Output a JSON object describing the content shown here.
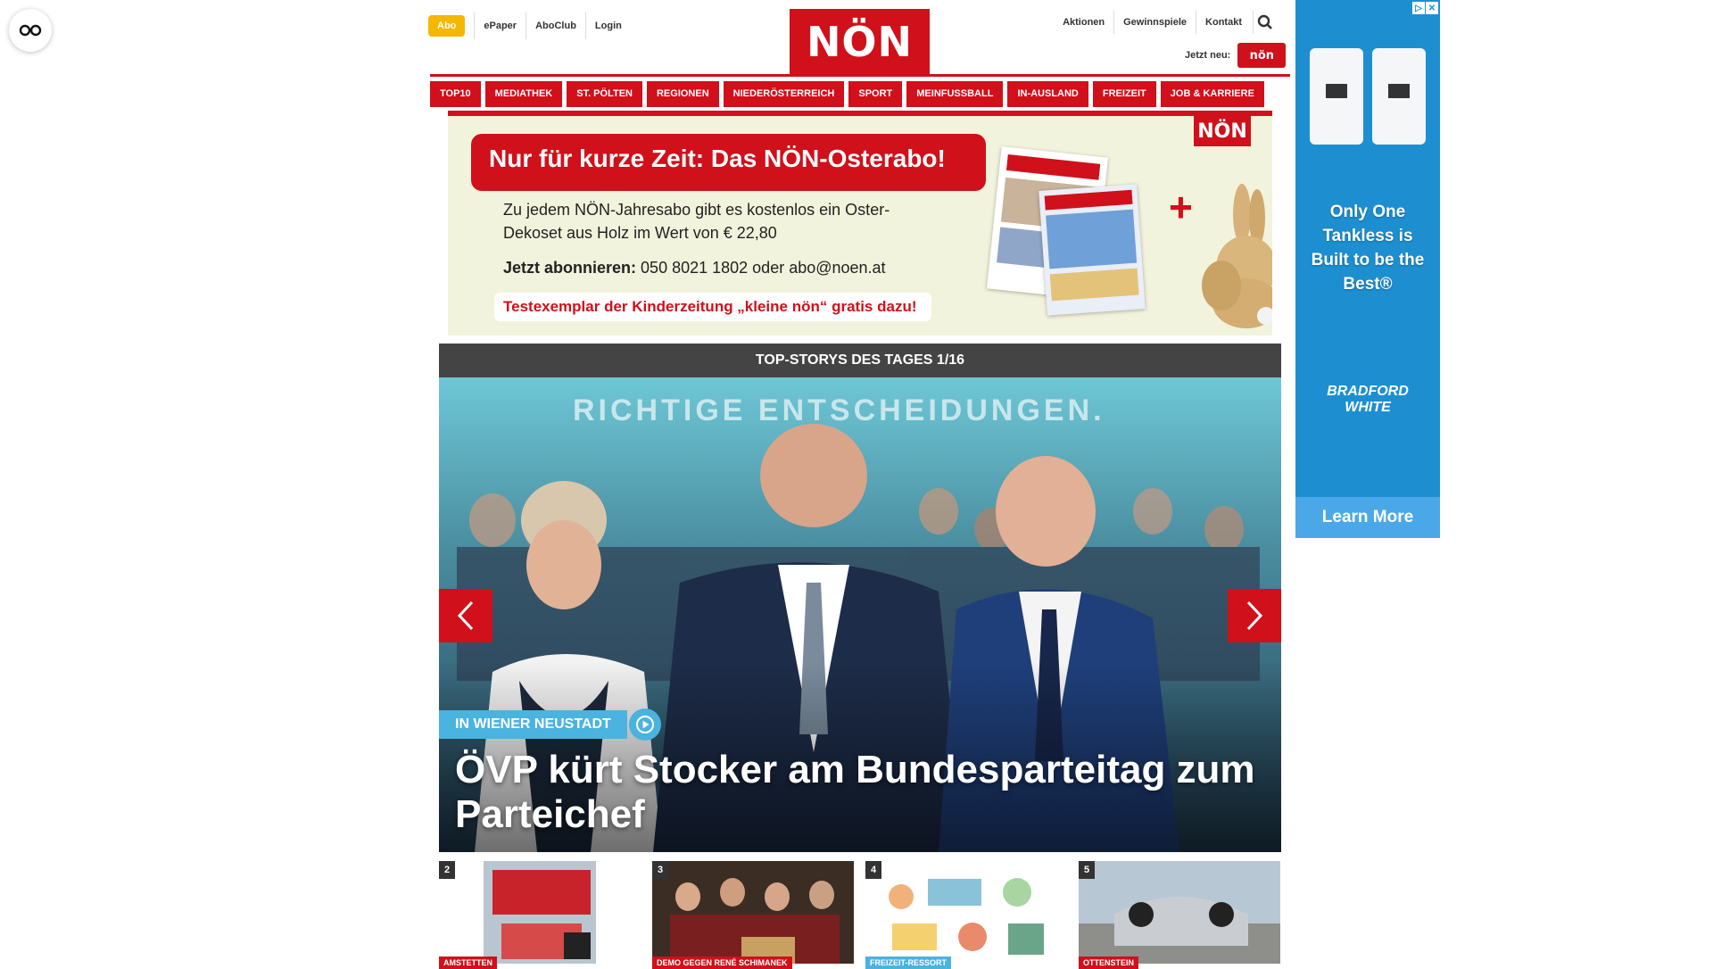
{
  "header": {
    "abo": "Abo",
    "left_links": [
      "ePaper",
      "AboClub",
      "Login"
    ],
    "logo": "NÖN",
    "right_links": [
      "Aktionen",
      "Gewinnspiele",
      "Kontakt"
    ],
    "jetzt_neu": "Jetzt neu:",
    "kleine_logo": "nön"
  },
  "nav": [
    "TOP10",
    "MEDIATHEK",
    "ST. PÖLTEN",
    "REGIONEN",
    "NIEDERÖSTERREICH",
    "SPORT",
    "MEINFUSSBALL",
    "IN-AUSLAND",
    "FREIZEIT",
    "JOB & KARRIERE"
  ],
  "promo": {
    "title": "Nur für kurze Zeit: Das NÖN-Osterabo!",
    "text": "Zu jedem NÖN-Jahresabo gibt es kostenlos ein Oster-Dekoset aus Holz im Wert von € 22,80",
    "order_label": "Jetzt abonnieren:",
    "order_value": "050 8021 1802 oder abo@noen.at",
    "test": "Testexemplar der Kinderzeitung „kleine nön“ gratis dazu!",
    "logo": "NÖN"
  },
  "topstories": {
    "bar": "TOP-STORYS DES TAGES 1/16",
    "hero_tag": "IN WIENER NEUSTADT",
    "hero_title": "ÖVP kürt Stocker am Bundesparteitag zum Parteichef",
    "banner_text": "RICHTIGE ENTSCHEIDUNGEN."
  },
  "thumbs": [
    {
      "num": "2",
      "tag": "AMSTETTEN"
    },
    {
      "num": "3",
      "tag": "DEMO GEGEN RENÉ SCHIMANEK"
    },
    {
      "num": "4",
      "tag": "FREIZEIT-RESSORT"
    },
    {
      "num": "5",
      "tag": "OTTENSTEIN"
    }
  ],
  "ad": {
    "headline": "Only One Tankless is Built to be the Best®",
    "brand": "BRADFORD WHITE",
    "cta": "Learn More"
  },
  "colors": {
    "brand_red": "#d0101a",
    "abo_yellow": "#f5b700",
    "accent_blue": "#4ab3e0"
  }
}
